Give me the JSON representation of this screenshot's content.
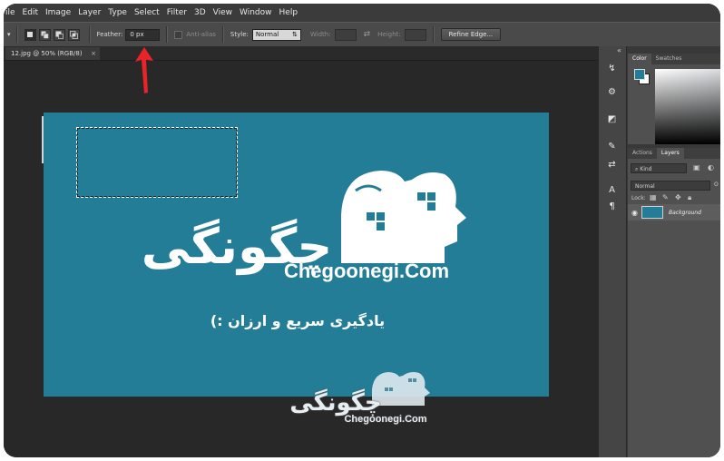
{
  "menubar": {
    "items": [
      "ile",
      "Edit",
      "Image",
      "Layer",
      "Type",
      "Select",
      "Filter",
      "3D",
      "View",
      "Window",
      "Help"
    ]
  },
  "options_bar": {
    "feather_label": "Feather:",
    "feather_value": "0 px",
    "antialias_label": "Anti-alias",
    "style_label": "Style:",
    "style_value": "Normal",
    "width_label": "Width:",
    "height_label": "Height:",
    "refine_edge_label": "Refine Edge..."
  },
  "document_tab": {
    "title": "12.jpg @ 50% (RGB/8)",
    "close_glyph": "×"
  },
  "canvas_image": {
    "background_color": "#237d96",
    "logo_persian": "چگونگی",
    "logo_latin": "Chegoonegi.Com",
    "tagline": "یادگیری سریع و ارزان :)"
  },
  "watermark": {
    "logo_persian": "چگونگی",
    "logo_latin": "Chegoonegi.Com"
  },
  "color_panel": {
    "tabs": [
      "Color",
      "Swatches"
    ],
    "fg_color": "#237d96",
    "bg_color": "#ffffff"
  },
  "layers_panel": {
    "tabs": [
      "Actions",
      "Layers"
    ],
    "kind_label": "Kind",
    "blend_mode": "Normal",
    "opacity_glyph": "O",
    "lock_label": "Lock:",
    "layer_name": "Background"
  },
  "annotation": {
    "color": "#e8242a"
  },
  "icons": {
    "collapse": "«",
    "chevron": "▾",
    "updown": "⇅",
    "swap": "⇄"
  }
}
